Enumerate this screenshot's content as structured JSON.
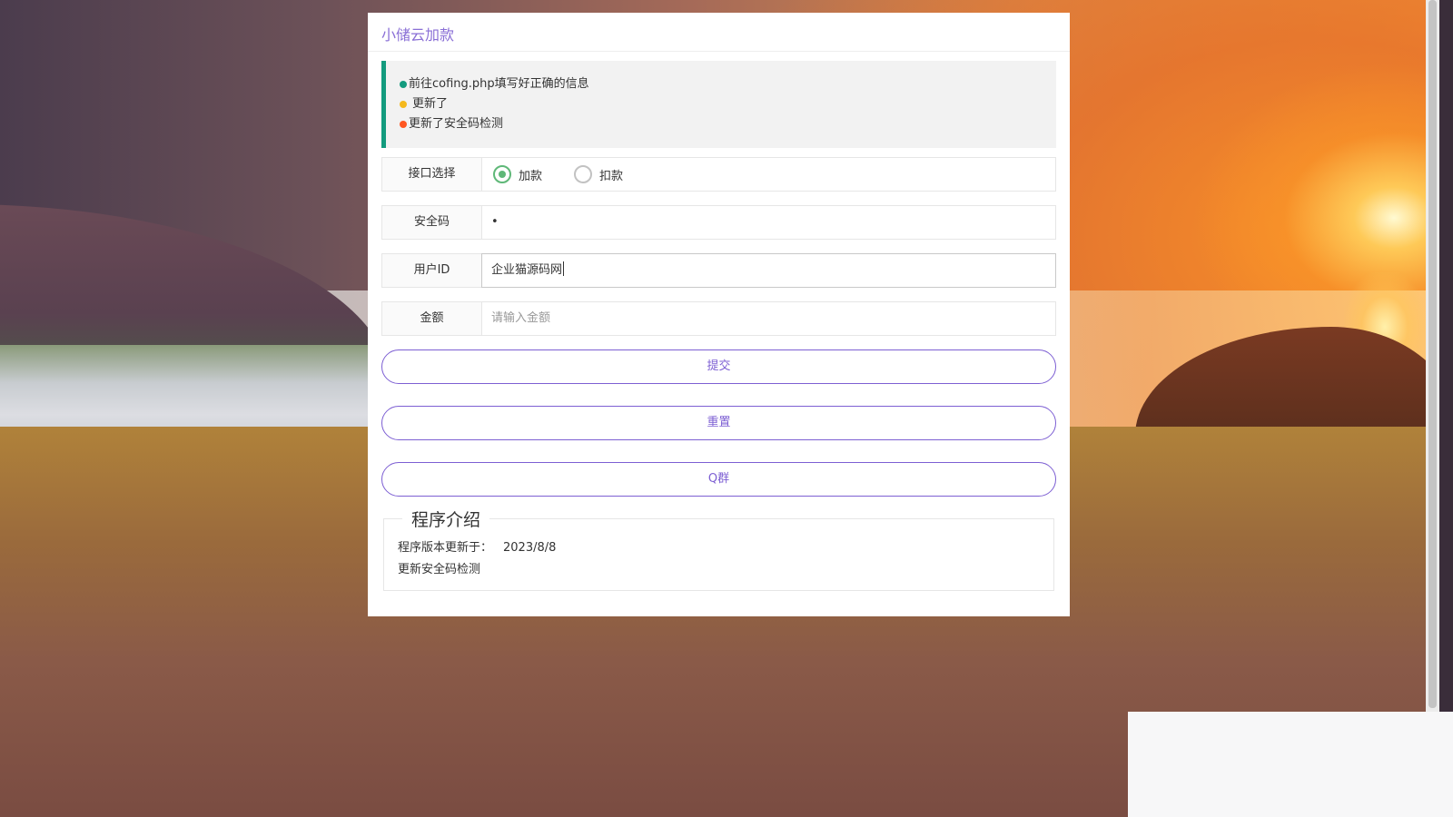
{
  "header": {
    "title": "小储云加款"
  },
  "notice": {
    "lines": [
      {
        "text": "前往cofing.php填写好正确的信息",
        "dot_color": "#139b7e"
      },
      {
        "text": "更新了",
        "dot_color": "#f5b91d"
      },
      {
        "text": "更新了安全码检测",
        "dot_color": "#ff5722"
      }
    ]
  },
  "form": {
    "interface": {
      "label": "接口选择",
      "options": [
        {
          "label": "加款",
          "checked": true
        },
        {
          "label": "扣款",
          "checked": false
        }
      ]
    },
    "security_code": {
      "label": "安全码",
      "value": "•"
    },
    "user_id": {
      "label": "用户ID",
      "value": "企业猫源码网"
    },
    "amount": {
      "label": "金额",
      "placeholder": "请输入金额"
    }
  },
  "buttons": {
    "submit": "提交",
    "reset": "重置",
    "qgroup": "Q群"
  },
  "intro": {
    "legend": "程序介绍",
    "version_label": "程序版本更新于：",
    "version_date": "2023/8/8",
    "update_note": "更新安全码检测"
  },
  "colors": {
    "accent": "#7d5fd3",
    "title": "#8a6fd6",
    "radio_checked": "#5fb878",
    "notice_border": "#139b7e"
  }
}
